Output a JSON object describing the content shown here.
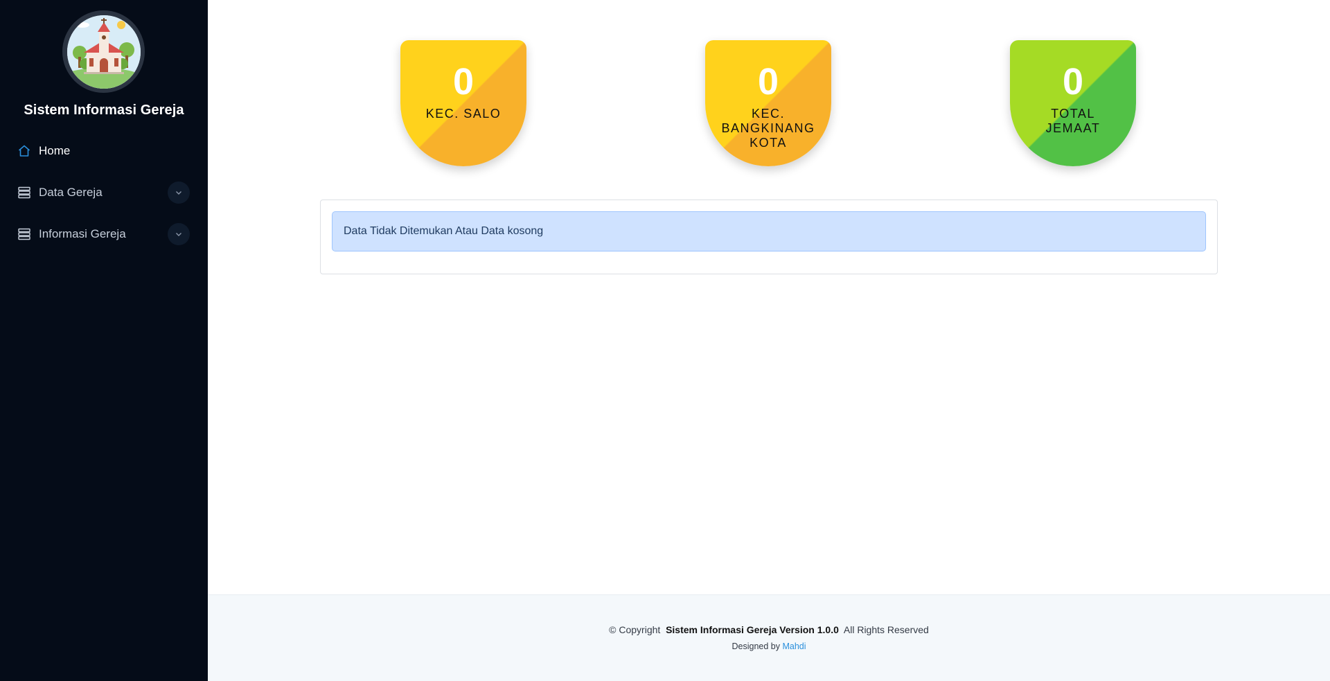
{
  "sidebar": {
    "brand_title": "Sistem Informasi Gereja",
    "items": [
      {
        "label": "Home",
        "icon": "home-icon",
        "active": true
      },
      {
        "label": "Data Gereja",
        "icon": "database-icon",
        "has_submenu": true
      },
      {
        "label": "Informasi Gereja",
        "icon": "database-icon",
        "has_submenu": true
      }
    ]
  },
  "stats": [
    {
      "value": "0",
      "label": "KEC. SALO",
      "color": "yellow"
    },
    {
      "value": "0",
      "label": "KEC. BANGKINANG KOTA",
      "color": "yellow"
    },
    {
      "value": "0",
      "label": "TOTAL JEMAAT",
      "color": "green"
    }
  ],
  "alert": {
    "text": "Data Tidak Ditemukan Atau Data kosong"
  },
  "footer": {
    "copyright_prefix": "© Copyright",
    "app_version": "Sistem Informasi Gereja Version 1.0.0",
    "rights": "All Rights Reserved",
    "designed_by_prefix": "Designed by",
    "designer": "Mahdi"
  },
  "colors": {
    "sidebar_bg": "#050c18",
    "accent_blue": "#2a8fdc",
    "badge_yellow": "#f8b12b",
    "badge_green": "#52c146",
    "alert_bg": "#cfe2ff"
  }
}
